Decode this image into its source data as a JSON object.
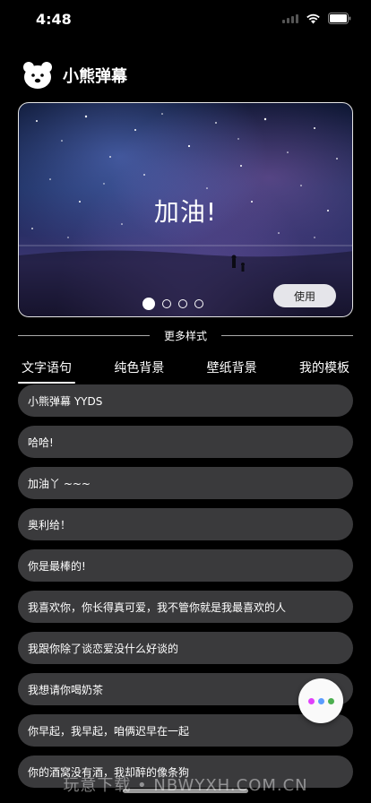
{
  "status": {
    "time": "4:48"
  },
  "app": {
    "title": "小熊弹幕"
  },
  "banner": {
    "text": "加油!",
    "use_label": "使用",
    "pages": 4,
    "active_page": 1
  },
  "divider": {
    "label": "更多样式"
  },
  "tabs": [
    {
      "label": "文字语句",
      "active": true
    },
    {
      "label": "纯色背景",
      "active": false
    },
    {
      "label": "壁纸背景",
      "active": false
    },
    {
      "label": "我的模板",
      "active": false
    }
  ],
  "phrases": [
    "小熊弹幕 YYDS",
    "哈哈!",
    "加油丫 ~~~",
    "奥利给！",
    "你是最棒的!",
    "我喜欢你，你长得真可爱，我不管你就是我最喜欢的人",
    "我跟你除了谈恋爱没什么好谈的",
    "我想请你喝奶茶",
    "你早起，我早起，咱俩迟早在一起",
    "你的酒窝没有酒，我却醉的像条狗"
  ],
  "fab": {
    "dot_colors": [
      "#e040fb",
      "#5b9cff",
      "#4caf50"
    ]
  },
  "watermark": "玩意下载 • NBWYXH.COM.CN",
  "colors": {
    "background": "#000000",
    "pill": "#3a3a3c",
    "button": "#e5e5ea"
  }
}
